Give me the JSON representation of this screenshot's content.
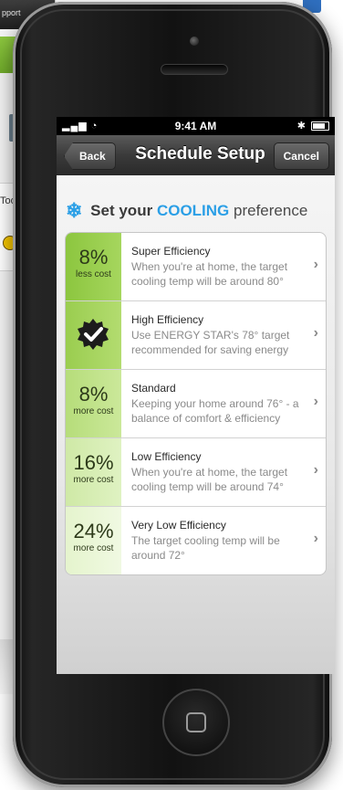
{
  "background": {
    "topbar_text": "pport",
    "panel_label": "Too"
  },
  "status_bar": {
    "signal": "..ıl",
    "time": "9:41 AM"
  },
  "nav": {
    "back_label": "Back",
    "title": "Schedule Setup",
    "cancel_label": "Cancel"
  },
  "heading": {
    "prefix": "Set your",
    "mode": "COOLING",
    "suffix": "preference",
    "icon": "snowflake-icon"
  },
  "options": [
    {
      "pct": "8%",
      "cost": "less cost",
      "title": "Super Efficiency",
      "desc": "When you're at home, the target cooling temp will be around 80°"
    },
    {
      "badge_icon": "energy-star-check-icon",
      "title": "High Efficiency",
      "desc": "Use ENERGY STAR's 78° target recommended for saving energy"
    },
    {
      "pct": "8%",
      "cost": "more cost",
      "title": "Standard",
      "desc": "Keeping your home around 76° - a balance of comfort & efficiency"
    },
    {
      "pct": "16%",
      "cost": "more cost",
      "title": "Low Efficiency",
      "desc": "When you're at home, the target cooling temp will be around 74°"
    },
    {
      "pct": "24%",
      "cost": "more cost",
      "title": "Very Low Efficiency",
      "desc": "The target cooling temp will be around 72°"
    }
  ],
  "colors": {
    "accent": "#2b9fe6",
    "efficiency_green": "#8cc63f"
  }
}
